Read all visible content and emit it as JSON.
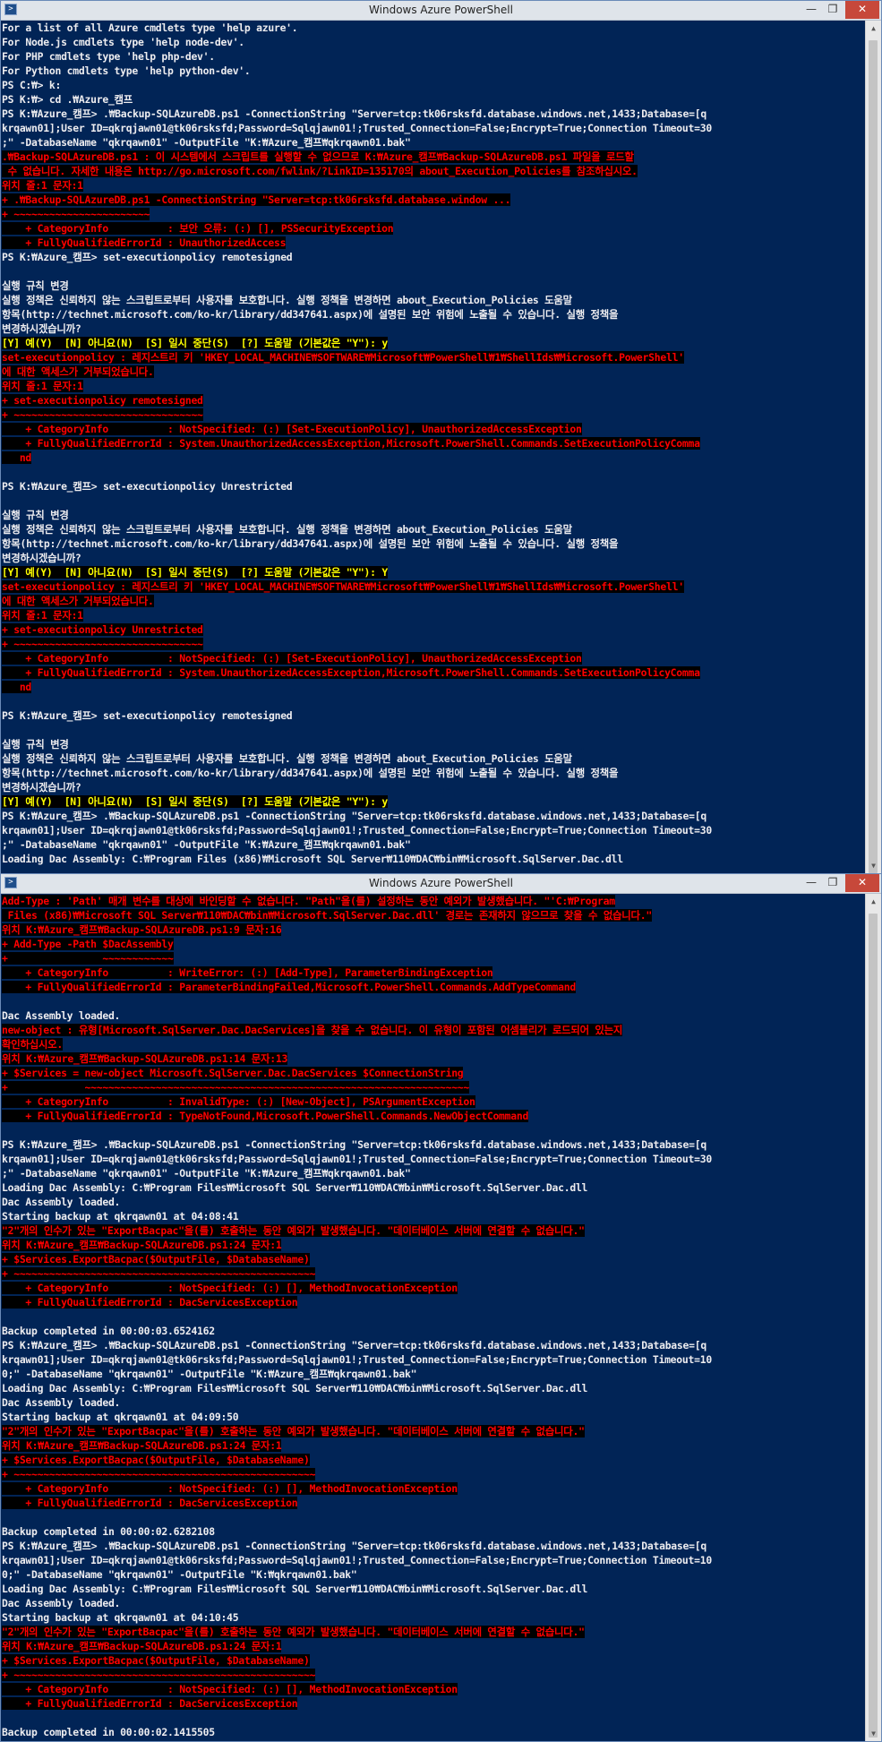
{
  "window1": {
    "title": "Windows Azure PowerShell",
    "lines": [
      {
        "t": "For a list of all Azure cmdlets type 'help azure'.",
        "c": "n"
      },
      {
        "t": "For Node.js cmdlets type 'help node-dev'.",
        "c": "n"
      },
      {
        "t": "For PHP cmdlets type 'help php-dev'.",
        "c": "n"
      },
      {
        "t": "For Python cmdlets type 'help python-dev'.",
        "c": "n"
      },
      {
        "t": "PS C:₩> k:",
        "c": "n"
      },
      {
        "t": "PS K:₩> cd .₩Azure_캠프",
        "c": "n"
      },
      {
        "t": "PS K:₩Azure_캠프> .₩Backup-SQLAzureDB.ps1 -ConnectionString \"Server=tcp:tk06rsksfd.database.windows.net,1433;Database=[q",
        "c": "n"
      },
      {
        "t": "krqawn01];User ID=qkrqjawn01@tk06rsksfd;Password=Sqlqjawn01!;Trusted_Connection=False;Encrypt=True;Connection Timeout=30",
        "c": "n"
      },
      {
        "t": ";\" -DatabaseName \"qkrqawn01\" -OutputFile \"K:₩Azure_캠프₩qkrqawn01.bak\"",
        "c": "n"
      },
      {
        "t": ".₩Backup-SQLAzureDB.ps1 : 이 시스템에서 스크립트를 실행할 수 없으므로 K:₩Azure_캠프₩Backup-SQLAzureDB.ps1 파일을 로드할",
        "c": "e"
      },
      {
        "t": " 수 없습니다. 자세한 내용은 http://go.microsoft.com/fwlink/?LinkID=135170의 about_Execution_Policies를 참조하십시오.",
        "c": "e"
      },
      {
        "t": "위치 줄:1 문자:1",
        "c": "e"
      },
      {
        "t": "+ .₩Backup-SQLAzureDB.ps1 -ConnectionString \"Server=tcp:tk06rsksfd.database.window ...",
        "c": "e"
      },
      {
        "t": "+ ~~~~~~~~~~~~~~~~~~~~~~~",
        "c": "e"
      },
      {
        "t": "    + CategoryInfo          : 보안 오류: (:) [], PSSecurityException",
        "c": "e"
      },
      {
        "t": "    + FullyQualifiedErrorId : UnauthorizedAccess",
        "c": "e"
      },
      {
        "t": "PS K:₩Azure_캠프> set-executionpolicy remotesigned",
        "c": "n"
      },
      {
        "t": "",
        "c": "n"
      },
      {
        "t": "실행 규칙 변경",
        "c": "n"
      },
      {
        "t": "실행 정책은 신뢰하지 않는 스크립트로부터 사용자를 보호합니다. 실행 정책을 변경하면 about_Execution_Policies 도움말",
        "c": "n"
      },
      {
        "t": "항목(http://technet.microsoft.com/ko-kr/library/dd347641.aspx)에 설명된 보안 위험에 노출될 수 있습니다. 실행 정책을",
        "c": "n"
      },
      {
        "t": "변경하시겠습니까?",
        "c": "n"
      },
      {
        "t": "[Y] 예(Y)  [N] 아니요(N)  [S] 일시 중단(S)  [?] 도움말 (기본값은 \"Y\"): y",
        "c": "y"
      },
      {
        "t": "set-executionpolicy : 레지스트리 키 'HKEY_LOCAL_MACHINE₩SOFTWARE₩Microsoft₩PowerShell₩1₩ShellIds₩Microsoft.PowerShell'",
        "c": "e"
      },
      {
        "t": "에 대한 액세스가 거부되었습니다.",
        "c": "e"
      },
      {
        "t": "위치 줄:1 문자:1",
        "c": "e"
      },
      {
        "t": "+ set-executionpolicy remotesigned",
        "c": "e"
      },
      {
        "t": "+ ~~~~~~~~~~~~~~~~~~~~~~~~~~~~~~~~",
        "c": "e"
      },
      {
        "t": "    + CategoryInfo          : NotSpecified: (:) [Set-ExecutionPolicy], UnauthorizedAccessException",
        "c": "e"
      },
      {
        "t": "    + FullyQualifiedErrorId : System.UnauthorizedAccessException,Microsoft.PowerShell.Commands.SetExecutionPolicyComma",
        "c": "e"
      },
      {
        "t": "   nd",
        "c": "e"
      },
      {
        "t": "",
        "c": "n"
      },
      {
        "t": "PS K:₩Azure_캠프> set-executionpolicy Unrestricted",
        "c": "n"
      },
      {
        "t": "",
        "c": "n"
      },
      {
        "t": "실행 규칙 변경",
        "c": "n"
      },
      {
        "t": "실행 정책은 신뢰하지 않는 스크립트로부터 사용자를 보호합니다. 실행 정책을 변경하면 about_Execution_Policies 도움말",
        "c": "n"
      },
      {
        "t": "항목(http://technet.microsoft.com/ko-kr/library/dd347641.aspx)에 설명된 보안 위험에 노출될 수 있습니다. 실행 정책을",
        "c": "n"
      },
      {
        "t": "변경하시겠습니까?",
        "c": "n"
      },
      {
        "t": "[Y] 예(Y)  [N] 아니요(N)  [S] 일시 중단(S)  [?] 도움말 (기본값은 \"Y\"): Y",
        "c": "y"
      },
      {
        "t": "set-executionpolicy : 레지스트리 키 'HKEY_LOCAL_MACHINE₩SOFTWARE₩Microsoft₩PowerShell₩1₩ShellIds₩Microsoft.PowerShell'",
        "c": "e"
      },
      {
        "t": "에 대한 액세스가 거부되었습니다.",
        "c": "e"
      },
      {
        "t": "위치 줄:1 문자:1",
        "c": "e"
      },
      {
        "t": "+ set-executionpolicy Unrestricted",
        "c": "e"
      },
      {
        "t": "+ ~~~~~~~~~~~~~~~~~~~~~~~~~~~~~~~~",
        "c": "e"
      },
      {
        "t": "    + CategoryInfo          : NotSpecified: (:) [Set-ExecutionPolicy], UnauthorizedAccessException",
        "c": "e"
      },
      {
        "t": "    + FullyQualifiedErrorId : System.UnauthorizedAccessException,Microsoft.PowerShell.Commands.SetExecutionPolicyComma",
        "c": "e"
      },
      {
        "t": "   nd",
        "c": "e"
      },
      {
        "t": "",
        "c": "n"
      },
      {
        "t": "PS K:₩Azure_캠프> set-executionpolicy remotesigned",
        "c": "n"
      },
      {
        "t": "",
        "c": "n"
      },
      {
        "t": "실행 규칙 변경",
        "c": "n"
      },
      {
        "t": "실행 정책은 신뢰하지 않는 스크립트로부터 사용자를 보호합니다. 실행 정책을 변경하면 about_Execution_Policies 도움말",
        "c": "n"
      },
      {
        "t": "항목(http://technet.microsoft.com/ko-kr/library/dd347641.aspx)에 설명된 보안 위험에 노출될 수 있습니다. 실행 정책을",
        "c": "n"
      },
      {
        "t": "변경하시겠습니까?",
        "c": "n"
      },
      {
        "t": "[Y] 예(Y)  [N] 아니요(N)  [S] 일시 중단(S)  [?] 도움말 (기본값은 \"Y\"): y",
        "c": "y"
      },
      {
        "t": "PS K:₩Azure_캠프> .₩Backup-SQLAzureDB.ps1 -ConnectionString \"Server=tcp:tk06rsksfd.database.windows.net,1433;Database=[q",
        "c": "n"
      },
      {
        "t": "krqawn01];User ID=qkrqjawn01@tk06rsksfd;Password=Sqlqjawn01!;Trusted_Connection=False;Encrypt=True;Connection Timeout=30",
        "c": "n"
      },
      {
        "t": ";\" -DatabaseName \"qkrqawn01\" -OutputFile \"K:₩Azure_캠프₩qkrqawn01.bak\"",
        "c": "n"
      },
      {
        "t": "Loading Dac Assembly: C:₩Program Files (x86)₩Microsoft SQL Server₩110₩DAC₩bin₩Microsoft.SqlServer.Dac.dll",
        "c": "n"
      }
    ]
  },
  "window2": {
    "title": "Windows Azure PowerShell",
    "lines": [
      {
        "t": "Add-Type : 'Path' 매개 변수를 대상에 바인딩할 수 없습니다. \"Path\"을(를) 설정하는 동안 예외가 발생했습니다. \"'C:₩Program",
        "c": "e"
      },
      {
        "t": " Files (x86)₩Microsoft SQL Server₩110₩DAC₩bin₩Microsoft.SqlServer.Dac.dll' 경로는 존재하지 않으므로 찾을 수 없습니다.\"",
        "c": "e"
      },
      {
        "t": "위치 K:₩Azure_캠프₩Backup-SQLAzureDB.ps1:9 문자:16",
        "c": "e"
      },
      {
        "t": "+ Add-Type -Path $DacAssembly",
        "c": "e"
      },
      {
        "t": "+                ~~~~~~~~~~~~",
        "c": "e"
      },
      {
        "t": "    + CategoryInfo          : WriteError: (:) [Add-Type], ParameterBindingException",
        "c": "e"
      },
      {
        "t": "    + FullyQualifiedErrorId : ParameterBindingFailed,Microsoft.PowerShell.Commands.AddTypeCommand",
        "c": "e"
      },
      {
        "t": "",
        "c": "n"
      },
      {
        "t": "Dac Assembly loaded.",
        "c": "n"
      },
      {
        "t": "new-object : 유형[Microsoft.SqlServer.Dac.DacServices]을 찾을 수 없습니다. 이 유형이 포함된 어셈블리가 로드되어 있는지",
        "c": "e"
      },
      {
        "t": "확인하십시오.",
        "c": "e"
      },
      {
        "t": "위치 K:₩Azure_캠프₩Backup-SQLAzureDB.ps1:14 문자:13",
        "c": "e"
      },
      {
        "t": "+ $Services = new-object Microsoft.SqlServer.Dac.DacServices $ConnectionString",
        "c": "e"
      },
      {
        "t": "+             ~~~~~~~~~~~~~~~~~~~~~~~~~~~~~~~~~~~~~~~~~~~~~~~~~~~~~~~~~~~~~~~~~",
        "c": "e"
      },
      {
        "t": "    + CategoryInfo          : InvalidType: (:) [New-Object], PSArgumentException",
        "c": "e"
      },
      {
        "t": "    + FullyQualifiedErrorId : TypeNotFound,Microsoft.PowerShell.Commands.NewObjectCommand",
        "c": "e"
      },
      {
        "t": "",
        "c": "n"
      },
      {
        "t": "PS K:₩Azure_캠프> .₩Backup-SQLAzureDB.ps1 -ConnectionString \"Server=tcp:tk06rsksfd.database.windows.net,1433;Database=[q",
        "c": "n"
      },
      {
        "t": "krqawn01];User ID=qkrqjawn01@tk06rsksfd;Password=Sqlqjawn01!;Trusted_Connection=False;Encrypt=True;Connection Timeout=30",
        "c": "n"
      },
      {
        "t": ";\" -DatabaseName \"qkrqawn01\" -OutputFile \"K:₩Azure_캠프₩qkrqawn01.bak\"",
        "c": "n"
      },
      {
        "t": "Loading Dac Assembly: C:₩Program Files₩Microsoft SQL Server₩110₩DAC₩bin₩Microsoft.SqlServer.Dac.dll",
        "c": "n"
      },
      {
        "t": "Dac Assembly loaded.",
        "c": "n"
      },
      {
        "t": "Starting backup at qkrqawn01 at 04:08:41",
        "c": "n"
      },
      {
        "t": "\"2\"개의 인수가 있는 \"ExportBacpac\"을(를) 호출하는 동안 예외가 발생했습니다. \"데이터베이스 서버에 연결할 수 없습니다.\"",
        "c": "e"
      },
      {
        "t": "위치 K:₩Azure_캠프₩Backup-SQLAzureDB.ps1:24 문자:1",
        "c": "e"
      },
      {
        "t": "+ $Services.ExportBacpac($OutputFile, $DatabaseName)",
        "c": "e"
      },
      {
        "t": "+ ~~~~~~~~~~~~~~~~~~~~~~~~~~~~~~~~~~~~~~~~~~~~~~~~~~~",
        "c": "e"
      },
      {
        "t": "    + CategoryInfo          : NotSpecified: (:) [], MethodInvocationException",
        "c": "e"
      },
      {
        "t": "    + FullyQualifiedErrorId : DacServicesException",
        "c": "e"
      },
      {
        "t": "",
        "c": "n"
      },
      {
        "t": "Backup completed in 00:00:03.6524162",
        "c": "n"
      },
      {
        "t": "PS K:₩Azure_캠프> .₩Backup-SQLAzureDB.ps1 -ConnectionString \"Server=tcp:tk06rsksfd.database.windows.net,1433;Database=[q",
        "c": "n"
      },
      {
        "t": "krqawn01];User ID=qkrqjawn01@tk06rsksfd;Password=Sqlqjawn01!;Trusted_Connection=False;Encrypt=True;Connection Timeout=10",
        "c": "n"
      },
      {
        "t": "0;\" -DatabaseName \"qkrqawn01\" -OutputFile \"K:₩Azure_캠프₩qkrqawn01.bak\"",
        "c": "n"
      },
      {
        "t": "Loading Dac Assembly: C:₩Program Files₩Microsoft SQL Server₩110₩DAC₩bin₩Microsoft.SqlServer.Dac.dll",
        "c": "n"
      },
      {
        "t": "Dac Assembly loaded.",
        "c": "n"
      },
      {
        "t": "Starting backup at qkrqawn01 at 04:09:50",
        "c": "n"
      },
      {
        "t": "\"2\"개의 인수가 있는 \"ExportBacpac\"을(를) 호출하는 동안 예외가 발생했습니다. \"데이터베이스 서버에 연결할 수 없습니다.\"",
        "c": "e"
      },
      {
        "t": "위치 K:₩Azure_캠프₩Backup-SQLAzureDB.ps1:24 문자:1",
        "c": "e"
      },
      {
        "t": "+ $Services.ExportBacpac($OutputFile, $DatabaseName)",
        "c": "e"
      },
      {
        "t": "+ ~~~~~~~~~~~~~~~~~~~~~~~~~~~~~~~~~~~~~~~~~~~~~~~~~~~",
        "c": "e"
      },
      {
        "t": "    + CategoryInfo          : NotSpecified: (:) [], MethodInvocationException",
        "c": "e"
      },
      {
        "t": "    + FullyQualifiedErrorId : DacServicesException",
        "c": "e"
      },
      {
        "t": "",
        "c": "n"
      },
      {
        "t": "Backup completed in 00:00:02.6282108",
        "c": "n"
      },
      {
        "t": "PS K:₩Azure_캠프> .₩Backup-SQLAzureDB.ps1 -ConnectionString \"Server=tcp:tk06rsksfd.database.windows.net,1433;Database=[q",
        "c": "n"
      },
      {
        "t": "krqawn01];User ID=qkrqjawn01@tk06rsksfd;Password=Sqlqjawn01!;Trusted_Connection=False;Encrypt=True;Connection Timeout=10",
        "c": "n"
      },
      {
        "t": "0;\" -DatabaseName \"qkrqawn01\" -OutputFile \"K:₩qkrqawn01.bak\"",
        "c": "n"
      },
      {
        "t": "Loading Dac Assembly: C:₩Program Files₩Microsoft SQL Server₩110₩DAC₩bin₩Microsoft.SqlServer.Dac.dll",
        "c": "n"
      },
      {
        "t": "Dac Assembly loaded.",
        "c": "n"
      },
      {
        "t": "Starting backup at qkrqawn01 at 04:10:45",
        "c": "n"
      },
      {
        "t": "\"2\"개의 인수가 있는 \"ExportBacpac\"을(를) 호출하는 동안 예외가 발생했습니다. \"데이터베이스 서버에 연결할 수 없습니다.\"",
        "c": "e"
      },
      {
        "t": "위치 K:₩Azure_캠프₩Backup-SQLAzureDB.ps1:24 문자:1",
        "c": "e"
      },
      {
        "t": "+ $Services.ExportBacpac($OutputFile, $DatabaseName)",
        "c": "e"
      },
      {
        "t": "+ ~~~~~~~~~~~~~~~~~~~~~~~~~~~~~~~~~~~~~~~~~~~~~~~~~~~",
        "c": "e"
      },
      {
        "t": "    + CategoryInfo          : NotSpecified: (:) [], MethodInvocationException",
        "c": "e"
      },
      {
        "t": "    + FullyQualifiedErrorId : DacServicesException",
        "c": "e"
      },
      {
        "t": "",
        "c": "n"
      },
      {
        "t": "Backup completed in 00:00:02.1415505",
        "c": "n"
      }
    ]
  },
  "window_controls": {
    "minimize": "—",
    "maximize": "❐",
    "close": "✕"
  },
  "scrollbar": {
    "up": "▲",
    "down": "▼"
  },
  "colors": {
    "console_bg": "#012456",
    "text": "#eeedf0",
    "error": "#ff0000",
    "prompt_choice": "#ffff00",
    "error_bg": "#000000"
  }
}
